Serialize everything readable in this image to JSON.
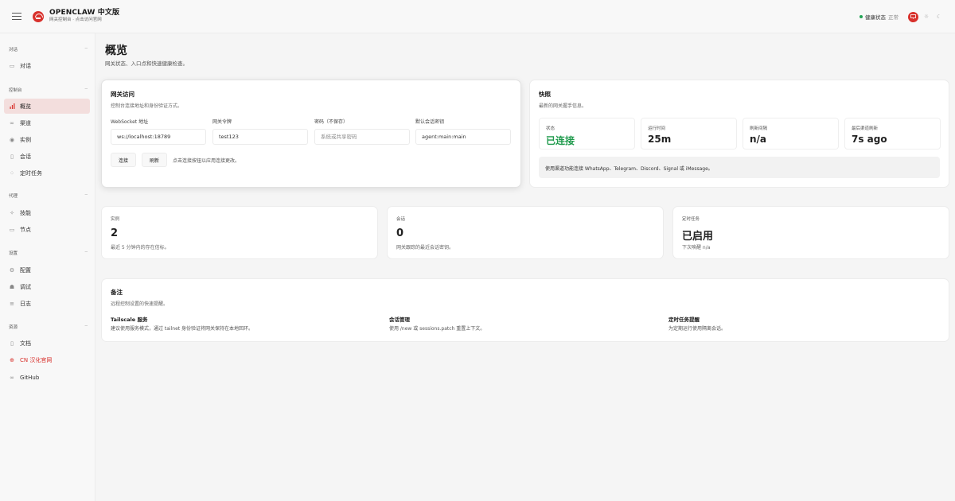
{
  "app": {
    "title": "OPENCLAW 中文版",
    "subtitle": "网关控制台 · 点击访问官网"
  },
  "header": {
    "health_label": "健康状态",
    "health_value": "正常",
    "theme_icons": [
      "monitor-icon",
      "sun-icon",
      "moon-icon"
    ]
  },
  "colors": {
    "accent": "#d8312c",
    "active_nav_bg": "#f3dedd",
    "status_ok": "#1f9a4c",
    "background": "#f5f5f5"
  },
  "sidebar": {
    "groups": [
      {
        "title": "对话",
        "collapse": "−",
        "items": [
          {
            "label": "对话",
            "icon": "chat-icon"
          }
        ]
      },
      {
        "title": "控制台",
        "collapse": "−",
        "items": [
          {
            "label": "概览",
            "icon": "bar-chart-icon",
            "active": true
          },
          {
            "label": "渠道",
            "icon": "link-icon"
          },
          {
            "label": "实例",
            "icon": "radio-icon"
          },
          {
            "label": "会话",
            "icon": "document-icon"
          },
          {
            "label": "定时任务",
            "icon": "loader-icon"
          }
        ]
      },
      {
        "title": "代理",
        "collapse": "−",
        "items": [
          {
            "label": "技能",
            "icon": "sparkle-icon"
          },
          {
            "label": "节点",
            "icon": "monitor-icon"
          }
        ]
      },
      {
        "title": "设置",
        "collapse": "−",
        "items": [
          {
            "label": "配置",
            "icon": "gear-icon"
          },
          {
            "label": "调试",
            "icon": "bug-icon"
          },
          {
            "label": "日志",
            "icon": "file-text-icon"
          }
        ]
      },
      {
        "title": "资源",
        "collapse": "−",
        "items": [
          {
            "label": "文档",
            "icon": "book-icon"
          },
          {
            "label": "CN 汉化官网",
            "icon": "globe-icon",
            "highlight": true
          },
          {
            "label": "GitHub",
            "icon": "link-icon"
          }
        ]
      }
    ]
  },
  "page": {
    "title": "概览",
    "subtitle": "网关状态、入口点和快速健康检查。"
  },
  "gateway_access": {
    "title": "网关访问",
    "subtitle": "控制台连接地址和身份验证方式。",
    "fields": [
      {
        "label": "WebSocket 地址",
        "value": "ws://localhost:18789",
        "placeholder": ""
      },
      {
        "label": "网关令牌",
        "value": "test123",
        "placeholder": ""
      },
      {
        "label": "密码（不保存）",
        "value": "",
        "placeholder": "系统或共享密码"
      },
      {
        "label": "默认会话密钥",
        "value": "agent:main:main",
        "placeholder": ""
      }
    ],
    "connect_label": "连接",
    "refresh_label": "刷新",
    "hint": "点击连接按钮以应用连接更改。"
  },
  "snapshot": {
    "title": "快照",
    "subtitle": "最新的网关握手信息。",
    "stats": [
      {
        "label": "状态",
        "value": "已连接"
      },
      {
        "label": "运行时间",
        "value": "25m"
      },
      {
        "label": "刷新间隔",
        "value": "n/a"
      },
      {
        "label": "最后渠道刷新",
        "value": "7s ago"
      }
    ],
    "note": "使用渠道功能连接 WhatsApp、Telegram、Discord、Signal 或 iMessage。"
  },
  "metrics": [
    {
      "label": "实例",
      "value": "2",
      "desc": "最近 5 分钟内的存在信标。"
    },
    {
      "label": "会话",
      "value": "0",
      "desc": "网关跟踪的最近会话密钥。"
    },
    {
      "label": "定时任务",
      "value": "已启用",
      "desc": "下次唤醒 n/a"
    }
  ],
  "notes": {
    "title": "备注",
    "subtitle": "远程控制设置的快速提醒。",
    "items": [
      {
        "title": "Tailscale 服务",
        "text": "建议使用服务模式，通过 tailnet 身份验证将网关保持在本地回环。"
      },
      {
        "title": "会话管理",
        "text": "使用 /new 或 sessions.patch 重置上下文。"
      },
      {
        "title": "定时任务提醒",
        "text": "为定期运行使用隔离会话。"
      }
    ]
  }
}
